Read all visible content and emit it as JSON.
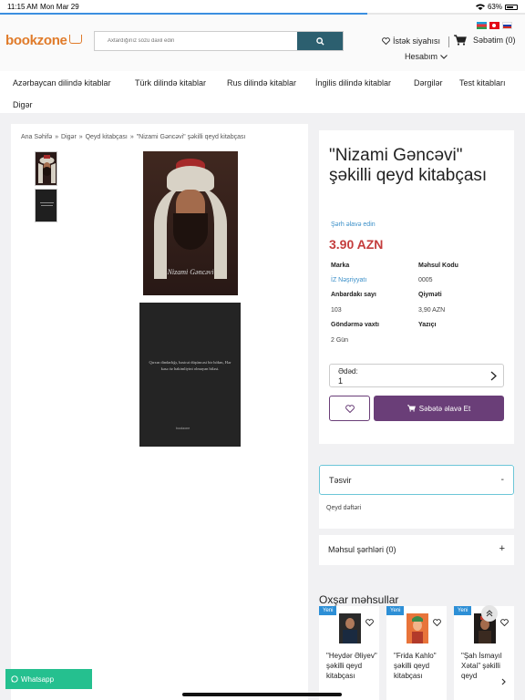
{
  "status_bar": {
    "time": "11:15 AM",
    "date": "Mon Mar 29",
    "battery": "63%"
  },
  "page_load_progress": 0.7,
  "header": {
    "logo": "bookzone",
    "search_placeholder": "Axtardığınız sözü daxil edin",
    "wishlist_label": "İstək siyahısı",
    "cart_label": "Səbətim (0)",
    "account_label": "Hesabım",
    "languages": [
      "az",
      "tr",
      "ru"
    ]
  },
  "nav": {
    "items": [
      "Azərbaycan dilində kitablar",
      "Türk dilində kitablar",
      "Rus dilində kitablar",
      "İngilis dilində kitablar",
      "Dərgilər",
      "Test kitabları",
      "Digər"
    ]
  },
  "breadcrumb": [
    "Ana Səhifə",
    "Digər",
    "Qeyd kitabçası",
    "\"Nizami Gəncəvi\" şəkilli qeyd kitabçası"
  ],
  "gallery": {
    "image1_caption": "Nizami Gəncəvi",
    "image2_quote": "Qırxın dindarlığı, bəsirət düşüncəsi bir hökm, Hər kəsə öz hakimliyini olmayan biləsi.",
    "image2_brand": "bookzone"
  },
  "product": {
    "title": "\"Nizami Gəncəvi\" şəkilli qeyd kitabçası",
    "add_review": "Şərh əlavə edin",
    "price": "3.90 AZN",
    "specs": [
      {
        "label": "Marka",
        "value": "İZ Nəşriyyatı"
      },
      {
        "label": "Məhsul Kodu",
        "value": "0005"
      },
      {
        "label": "Anbardakı sayı",
        "value": "103"
      },
      {
        "label": "Qiyməti",
        "value": "3,90 AZN"
      },
      {
        "label": "Göndərmə vaxtı",
        "value": "2 Gün"
      },
      {
        "label": "Yazıçı",
        "value": ""
      }
    ],
    "quantity_label": "Ədəd:",
    "quantity_value": "1",
    "add_to_cart": "Səbətə əlavə Et"
  },
  "accordion": {
    "description_title": "Təsvir",
    "description_sign": "-",
    "description_body": "Qeyd dəftəri",
    "reviews_title": "Məhsul şərhləri (0)",
    "reviews_sign": "+"
  },
  "similar": {
    "title": "Oxşar məhsullar",
    "items": [
      {
        "badge": "Yeni",
        "title": "\"Heydər Əliyev\" şəkilli qeyd kitabçası"
      },
      {
        "badge": "Yeni",
        "title": "\"Frida Kahlo\" şəkilli qeyd kitabçası"
      },
      {
        "badge": "Yeni",
        "title": "\"Şah İsmayıl Xətai\" şəkilli qeyd"
      }
    ]
  },
  "whatsapp_label": "Whatsapp",
  "colors": {
    "brand_orange": "#e07b2a",
    "search_button": "#2c5f6f",
    "primary_purple": "#6a3e78",
    "price_red": "#c43d3d",
    "badge_blue": "#2d8fd6",
    "whatsapp_green": "#25c08f"
  }
}
